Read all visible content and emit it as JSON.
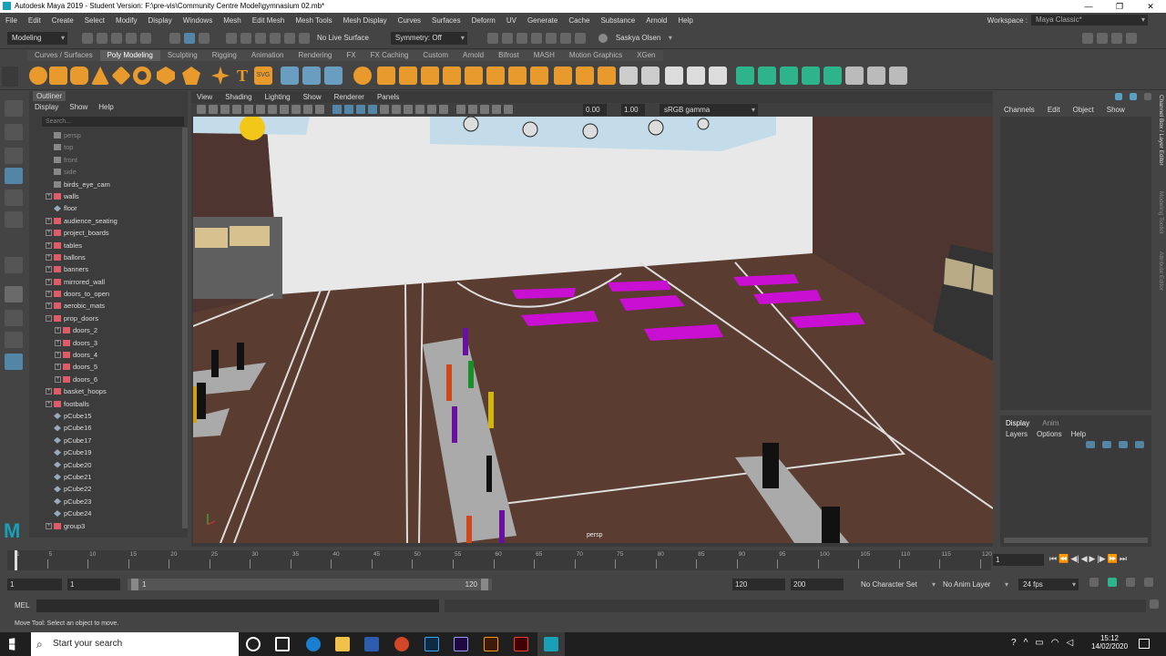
{
  "window": {
    "title": "Autodesk Maya 2019 - Student Version: F:\\pre-vis\\Community Centre Model\\gymnasium 02.mb*",
    "controls": [
      "—",
      "❐",
      "✕"
    ]
  },
  "menus": [
    "File",
    "Edit",
    "Create",
    "Select",
    "Modify",
    "Display",
    "Windows",
    "Mesh",
    "Edit Mesh",
    "Mesh Tools",
    "Mesh Display",
    "Curves",
    "Surfaces",
    "Deform",
    "UV",
    "Generate",
    "Cache",
    "Substance",
    "Arnold",
    "Help"
  ],
  "workspace": {
    "label": "Workspace :",
    "value": "Maya Classic*"
  },
  "statusline": {
    "mode": "Modeling",
    "live_surface": "No Live Surface",
    "symmetry": "Symmetry: Off",
    "user": "Saskya Olsen"
  },
  "shelf_tabs": [
    "Curves / Surfaces",
    "Poly Modeling",
    "Sculpting",
    "Rigging",
    "Animation",
    "Rendering",
    "FX",
    "FX Caching",
    "Custom",
    "Arnold",
    "Bifrost",
    "MASH",
    "Motion Graphics",
    "XGen"
  ],
  "shelf_active": "Poly Modeling",
  "outliner": {
    "title": "Outliner",
    "menu": [
      "Display",
      "Show",
      "Help"
    ],
    "search_placeholder": "Search...",
    "items": [
      {
        "label": "persp",
        "indent": 0,
        "exp": false,
        "type": "cam",
        "dim": true
      },
      {
        "label": "top",
        "indent": 0,
        "exp": false,
        "type": "cam",
        "dim": true
      },
      {
        "label": "front",
        "indent": 0,
        "exp": false,
        "type": "cam",
        "dim": true
      },
      {
        "label": "side",
        "indent": 0,
        "exp": false,
        "type": "cam",
        "dim": true
      },
      {
        "label": "birds_eye_cam",
        "indent": 0,
        "exp": false,
        "type": "cam",
        "dim": false
      },
      {
        "label": "walls",
        "indent": 0,
        "exp": "+",
        "type": "grp",
        "dim": false
      },
      {
        "label": "floor",
        "indent": 0,
        "exp": false,
        "type": "mesh",
        "dim": false
      },
      {
        "label": "audience_seating",
        "indent": 0,
        "exp": "+",
        "type": "grp",
        "dim": false
      },
      {
        "label": "project_boards",
        "indent": 0,
        "exp": "+",
        "type": "grp",
        "dim": false
      },
      {
        "label": "tables",
        "indent": 0,
        "exp": "+",
        "type": "grp",
        "dim": false
      },
      {
        "label": "ballons",
        "indent": 0,
        "exp": "+",
        "type": "grp",
        "dim": false
      },
      {
        "label": "banners",
        "indent": 0,
        "exp": "+",
        "type": "grp",
        "dim": false
      },
      {
        "label": "mirrored_wall",
        "indent": 0,
        "exp": "+",
        "type": "grp",
        "dim": false
      },
      {
        "label": "doors_to_open",
        "indent": 0,
        "exp": "+",
        "type": "grp",
        "dim": false
      },
      {
        "label": "aerobic_mats",
        "indent": 0,
        "exp": "+",
        "type": "grp",
        "dim": false
      },
      {
        "label": "prop_doors",
        "indent": 0,
        "exp": "−",
        "type": "grp",
        "dim": false
      },
      {
        "label": "doors_2",
        "indent": 1,
        "exp": "+",
        "type": "grp",
        "dim": false
      },
      {
        "label": "doors_3",
        "indent": 1,
        "exp": "+",
        "type": "grp",
        "dim": false
      },
      {
        "label": "doors_4",
        "indent": 1,
        "exp": "+",
        "type": "grp",
        "dim": false
      },
      {
        "label": "doors_5",
        "indent": 1,
        "exp": "+",
        "type": "grp",
        "dim": false
      },
      {
        "label": "doors_6",
        "indent": 1,
        "exp": "+",
        "type": "grp",
        "dim": false
      },
      {
        "label": "basket_hoops",
        "indent": 0,
        "exp": "+",
        "type": "grp",
        "dim": false
      },
      {
        "label": "footballs",
        "indent": 0,
        "exp": "+",
        "type": "grp",
        "dim": false
      },
      {
        "label": "pCube15",
        "indent": 0,
        "exp": false,
        "type": "mesh",
        "dim": false
      },
      {
        "label": "pCube16",
        "indent": 0,
        "exp": false,
        "type": "mesh",
        "dim": false
      },
      {
        "label": "pCube17",
        "indent": 0,
        "exp": false,
        "type": "mesh",
        "dim": false
      },
      {
        "label": "pCube19",
        "indent": 0,
        "exp": false,
        "type": "mesh",
        "dim": false
      },
      {
        "label": "pCube20",
        "indent": 0,
        "exp": false,
        "type": "mesh",
        "dim": false
      },
      {
        "label": "pCube21",
        "indent": 0,
        "exp": false,
        "type": "mesh",
        "dim": false
      },
      {
        "label": "pCube22",
        "indent": 0,
        "exp": false,
        "type": "mesh",
        "dim": false
      },
      {
        "label": "pCube23",
        "indent": 0,
        "exp": false,
        "type": "mesh",
        "dim": false
      },
      {
        "label": "pCube24",
        "indent": 0,
        "exp": false,
        "type": "mesh",
        "dim": false
      },
      {
        "label": "group3",
        "indent": 0,
        "exp": "+",
        "type": "grp",
        "dim": false
      }
    ]
  },
  "viewport": {
    "menu": [
      "View",
      "Shading",
      "Lighting",
      "Show",
      "Renderer",
      "Panels"
    ],
    "near": "0.00",
    "far": "1.00",
    "colorspace": "sRGB gamma",
    "camera_label": "persp"
  },
  "channelbox": {
    "menu": [
      "Channels",
      "Edit",
      "Object",
      "Show"
    ],
    "side_tabs": [
      "Channel Box / Layer Editor",
      "Modeling Toolkit",
      "Attribute Editor"
    ]
  },
  "layer_editor": {
    "tabs": [
      "Display",
      "Anim"
    ],
    "menu": [
      "Layers",
      "Options",
      "Help"
    ]
  },
  "timeline": {
    "ticks": [
      "1",
      "5",
      "10",
      "15",
      "20",
      "25",
      "30",
      "35",
      "40",
      "45",
      "50",
      "55",
      "60",
      "65",
      "70",
      "75",
      "80",
      "85",
      "90",
      "95",
      "100",
      "105",
      "110",
      "115",
      "120"
    ],
    "current_frame": "1"
  },
  "range": {
    "start": "1",
    "start2": "1",
    "slider_start": "1",
    "slider_end": "120",
    "end": "120",
    "end2": "200",
    "character_set": "No Character Set",
    "anim_layer": "No Anim Layer",
    "fps": "24 fps"
  },
  "mel": {
    "label": "MEL"
  },
  "help_line": "Move Tool: Select an object to move.",
  "taskbar": {
    "search": "Start your search",
    "time": "15:12",
    "date": "14/02/2020"
  },
  "colors": {
    "floor": "#5a3c30",
    "wall": "#e8e8e8",
    "mat": "#c80fd2",
    "accent": "#5285a6"
  }
}
